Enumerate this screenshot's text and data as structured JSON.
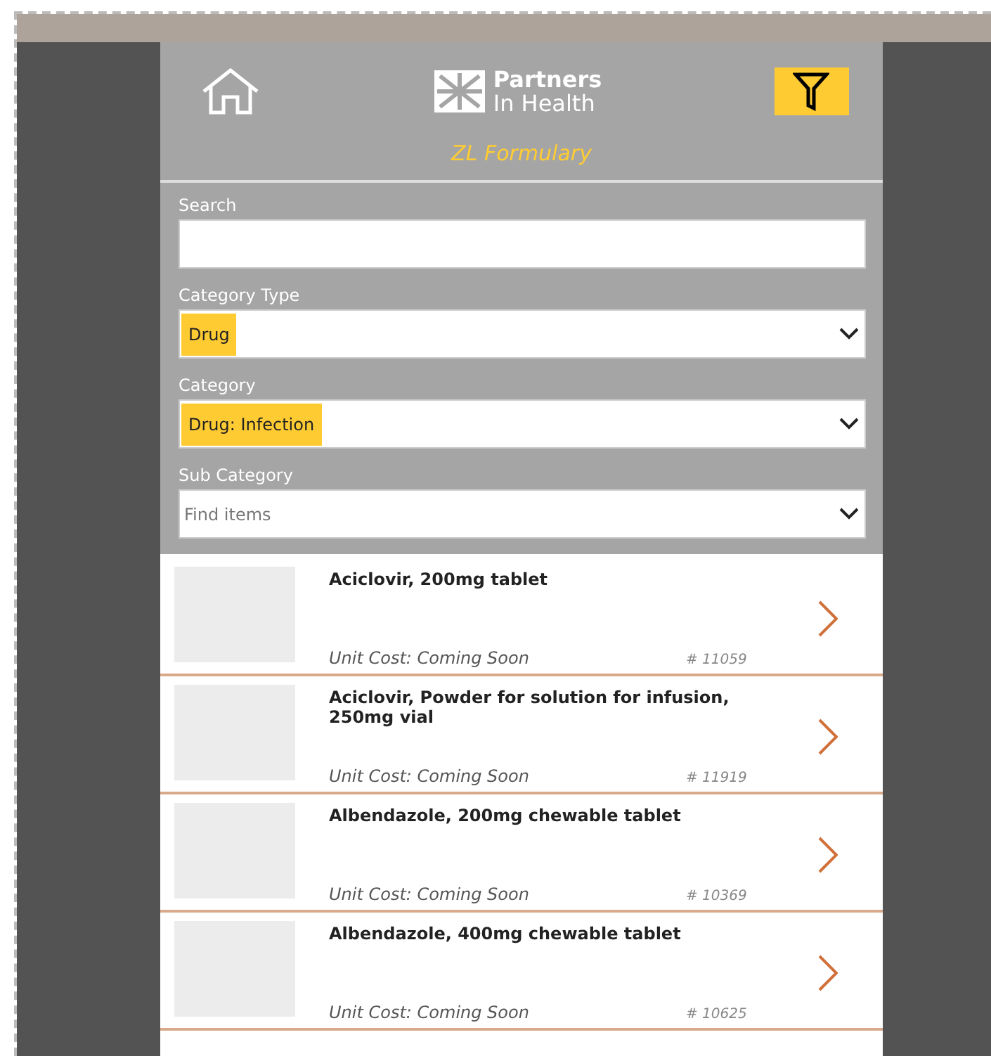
{
  "header": {
    "logo_line_1": "Partners",
    "logo_line_2": "In Health",
    "title": "ZL Formulary",
    "filter_active": true
  },
  "filters": [
    {
      "kind": "text",
      "label": "Search"
    },
    {
      "kind": "dropdown",
      "label": "Category Type",
      "value": "Drug"
    },
    {
      "kind": "dropdown",
      "label": "Category",
      "value": "Drug: Infection"
    },
    {
      "kind": "dropdown",
      "label": "Sub Category",
      "placeholder": "Find items"
    }
  ],
  "items": [
    {
      "name": "Aciclovir, 200mg tablet",
      "cost": "Unit Cost: Coming Soon",
      "number": "# 11059"
    },
    {
      "name": "Aciclovir, Powder for solution for infusion, 250mg vial",
      "cost": "Unit Cost: Coming Soon",
      "number": "# 11919"
    },
    {
      "name": "Albendazole, 200mg chewable tablet",
      "cost": "Unit Cost: Coming Soon",
      "number": "# 10369"
    },
    {
      "name": "Albendazole, 400mg chewable tablet",
      "cost": "Unit Cost: Coming Soon",
      "number": "# 10625"
    }
  ]
}
